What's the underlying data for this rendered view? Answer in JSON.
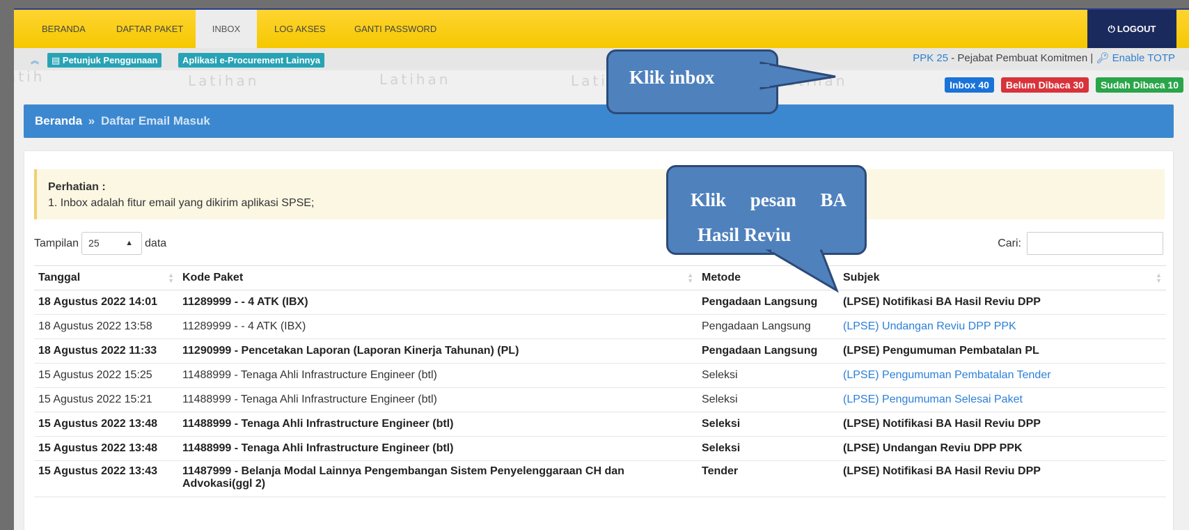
{
  "nav": {
    "items": [
      {
        "label": "BERANDA",
        "active": false
      },
      {
        "label": "DAFTAR PAKET",
        "active": false
      },
      {
        "label": "INBOX",
        "active": true
      },
      {
        "label": "LOG AKSES",
        "active": false
      },
      {
        "label": "GANTI PASSWORD",
        "active": false
      }
    ],
    "logout_label": "LOGOUT"
  },
  "subbar": {
    "guide_label": "Petunjuk Penggunaan",
    "apps_label": "Aplikasi e-Procurement Lainnya"
  },
  "user": {
    "name": "PPK 25",
    "role": " - Pejabat Pembuat Komitmen | ",
    "totp_label": "Enable TOTP"
  },
  "badges": {
    "inbox": "Inbox 40",
    "unread": "Belum Dibaca 30",
    "read": "Sudah Dibaca 10"
  },
  "watermark_text": "Latihan",
  "breadcrumb": {
    "home": "Beranda",
    "separator": "»",
    "current": "Daftar Email Masuk"
  },
  "notice": {
    "title": "Perhatian :",
    "text": "1. Inbox adalah fitur email yang dikirim aplikasi SPSE;"
  },
  "length_control": {
    "prefix": "Tampilan",
    "value": "25",
    "suffix": "data"
  },
  "search": {
    "label": "Cari:",
    "value": ""
  },
  "table": {
    "headers": [
      "Tanggal",
      "Kode Paket",
      "Metode",
      "Subjek"
    ],
    "rows": [
      {
        "tanggal": "18 Agustus 2022 14:01",
        "kode": "11289999 - - 4 ATK (IBX)",
        "metode": "Pengadaan Langsung",
        "subjek": "(LPSE) Notifikasi BA Hasil Reviu DPP",
        "unread": true
      },
      {
        "tanggal": "18 Agustus 2022 13:58",
        "kode": "11289999 - - 4 ATK (IBX)",
        "metode": "Pengadaan Langsung",
        "subjek": "(LPSE) Undangan Reviu DPP PPK",
        "unread": false
      },
      {
        "tanggal": "18 Agustus 2022 11:33",
        "kode": "11290999 - Pencetakan Laporan (Laporan Kinerja Tahunan) (PL)",
        "metode": "Pengadaan Langsung",
        "subjek": "(LPSE) Pengumuman Pembatalan PL",
        "unread": true
      },
      {
        "tanggal": "15 Agustus 2022 15:25",
        "kode": "11488999 - Tenaga Ahli Infrastructure Engineer (btl)",
        "metode": "Seleksi",
        "subjek": "(LPSE) Pengumuman Pembatalan Tender",
        "unread": false
      },
      {
        "tanggal": "15 Agustus 2022 15:21",
        "kode": "11488999 - Tenaga Ahli Infrastructure Engineer (btl)",
        "metode": "Seleksi",
        "subjek": "(LPSE) Pengumuman Selesai Paket",
        "unread": false
      },
      {
        "tanggal": "15 Agustus 2022 13:48",
        "kode": "11488999 - Tenaga Ahli Infrastructure Engineer (btl)",
        "metode": "Seleksi",
        "subjek": "(LPSE) Notifikasi BA Hasil Reviu DPP",
        "unread": true
      },
      {
        "tanggal": "15 Agustus 2022 13:48",
        "kode": "11488999 - Tenaga Ahli Infrastructure Engineer (btl)",
        "metode": "Seleksi",
        "subjek": "(LPSE) Undangan Reviu DPP PPK",
        "unread": true
      },
      {
        "tanggal": "15 Agustus 2022 13:43",
        "kode": "11487999 - Belanja Modal Lainnya Pengembangan Sistem Penyelenggaraan CH dan Advokasi(ggl 2)",
        "metode": "Tender",
        "subjek": "(LPSE) Notifikasi BA Hasil Reviu DPP",
        "unread": true
      }
    ]
  },
  "callouts": {
    "inbox": "Klik inbox",
    "message_line1_words": [
      "Klik",
      "pesan",
      "BA"
    ],
    "message_line2": "Hasil Reviu"
  },
  "colors": {
    "topbar": "#f5c800",
    "logout_bg": "#1b2a5c",
    "breadcrumb_bg": "#3c88d0",
    "link": "#2b7fd8",
    "callout_fill": "#4f81bd",
    "badge_blue": "#1a73d8",
    "badge_red": "#d8333b",
    "badge_green": "#2aa54a"
  }
}
